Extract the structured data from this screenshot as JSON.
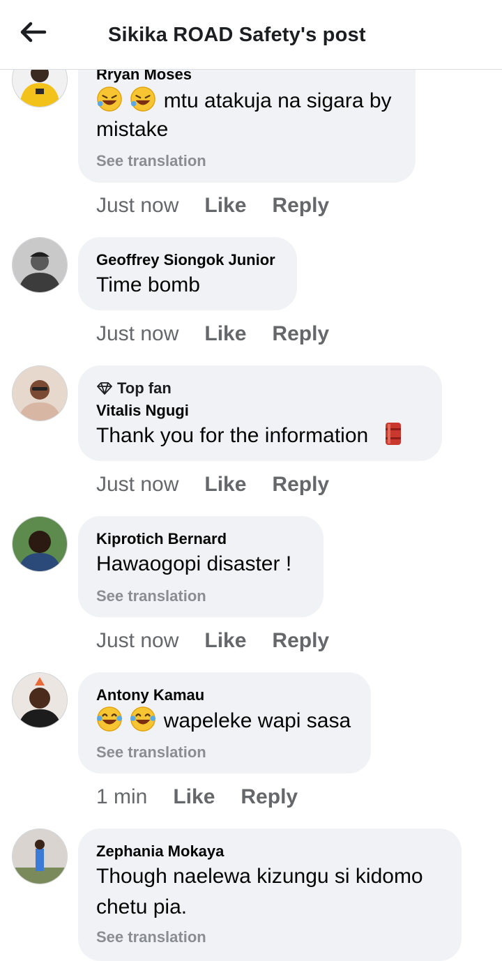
{
  "header": {
    "title": "Sikika ROAD Safety's post"
  },
  "comments": [
    {
      "author": "Rryan Moses",
      "text": "mtu atakuja na sigara by",
      "text2": "mistake",
      "see_translation": "See translation",
      "time": "Just now",
      "like": "Like",
      "reply": "Reply",
      "emoji": "rofl-emoji"
    },
    {
      "author": "Geoffrey Siongok Junior",
      "text": "Time bomb",
      "time": "Just now",
      "like": "Like",
      "reply": "Reply"
    },
    {
      "badge": "Top fan",
      "author": "Vitalis Ngugi",
      "text": "Thank you for the information",
      "time": "Just now",
      "like": "Like",
      "reply": "Reply",
      "emoji": "oil-drum-emoji"
    },
    {
      "author": "Kiprotich Bernard",
      "text": "Hawaogopi disaster !",
      "see_translation": "See translation",
      "time": "Just now",
      "like": "Like",
      "reply": "Reply"
    },
    {
      "author": "Antony Kamau",
      "text": "wapeleke wapi sasa",
      "see_translation": "See translation",
      "time": "1 min",
      "like": "Like",
      "reply": "Reply",
      "emoji": "tears-of-joy-emoji"
    },
    {
      "author": "Zephania Mokaya",
      "text": "Though naelewa kizungu si kidomo",
      "text2": "chetu pia.",
      "see_translation": "See translation"
    }
  ]
}
